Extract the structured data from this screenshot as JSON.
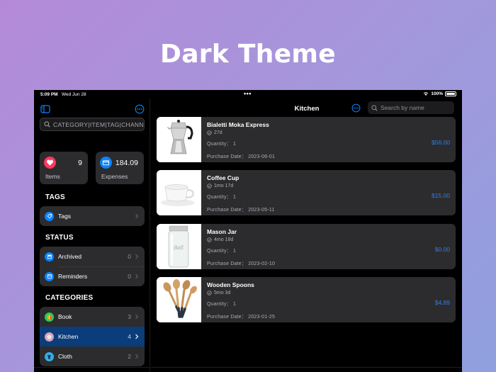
{
  "hero": {
    "title": "Dark Theme"
  },
  "status_bar": {
    "time": "5:09 PM",
    "date": "Wed Jun 28",
    "battery": "100%",
    "dots": "•••"
  },
  "sidebar": {
    "search": {
      "placeholder": "CATEGORY|ITEM|TAG|CHANNEL"
    },
    "stats": [
      {
        "value": "9",
        "label": "Items",
        "color": "#ff375f"
      },
      {
        "value": "184.09",
        "label": "Expenses",
        "color": "#0a84ff"
      }
    ],
    "tags_section": {
      "title": "TAGS",
      "items": [
        {
          "label": "Tags",
          "icon": "tag-icon"
        }
      ]
    },
    "status_section": {
      "title": "STATUS",
      "items": [
        {
          "label": "Archived",
          "count": "0",
          "icon": "archive-icon"
        },
        {
          "label": "Reminders",
          "count": "0",
          "icon": "reminder-icon"
        }
      ]
    },
    "categories_section": {
      "title": "CATEGORIES",
      "items": [
        {
          "label": "Book",
          "count": "3",
          "icon": "book-icon"
        },
        {
          "label": "Kitchen",
          "count": "4",
          "icon": "kitchen-icon",
          "selected": true
        },
        {
          "label": "Cloth",
          "count": "2",
          "icon": "cloth-icon"
        }
      ]
    }
  },
  "main": {
    "title": "Kitchen",
    "search": {
      "placeholder": "Search by name"
    },
    "items": [
      {
        "name": "Bialetti Moka Express",
        "age": "27d",
        "quantity": "Quantity： 1",
        "date": "Purchase Date： 2023-06-01",
        "price": "$56.00"
      },
      {
        "name": "Coffee Cup",
        "age": "1mo 17d",
        "quantity": "Quantity： 1",
        "date": "Purchase Date： 2023-05-11",
        "price": "$15.00"
      },
      {
        "name": "Mason Jar",
        "age": "4mo 18d",
        "quantity": "Quantity： 1",
        "date": "Purchase Date： 2023-02-10",
        "price": "$0.00"
      },
      {
        "name": "Wooden Spoons",
        "age": "5mo 3d",
        "quantity": "Quantity： 1",
        "date": "Purchase Date： 2023-01-25",
        "price": "$4.89"
      }
    ]
  },
  "colors": {
    "accent": "#0a84ff",
    "price": "#2f7fe8",
    "selected_row": "#0b3d7a",
    "card": "#2c2c2e"
  }
}
